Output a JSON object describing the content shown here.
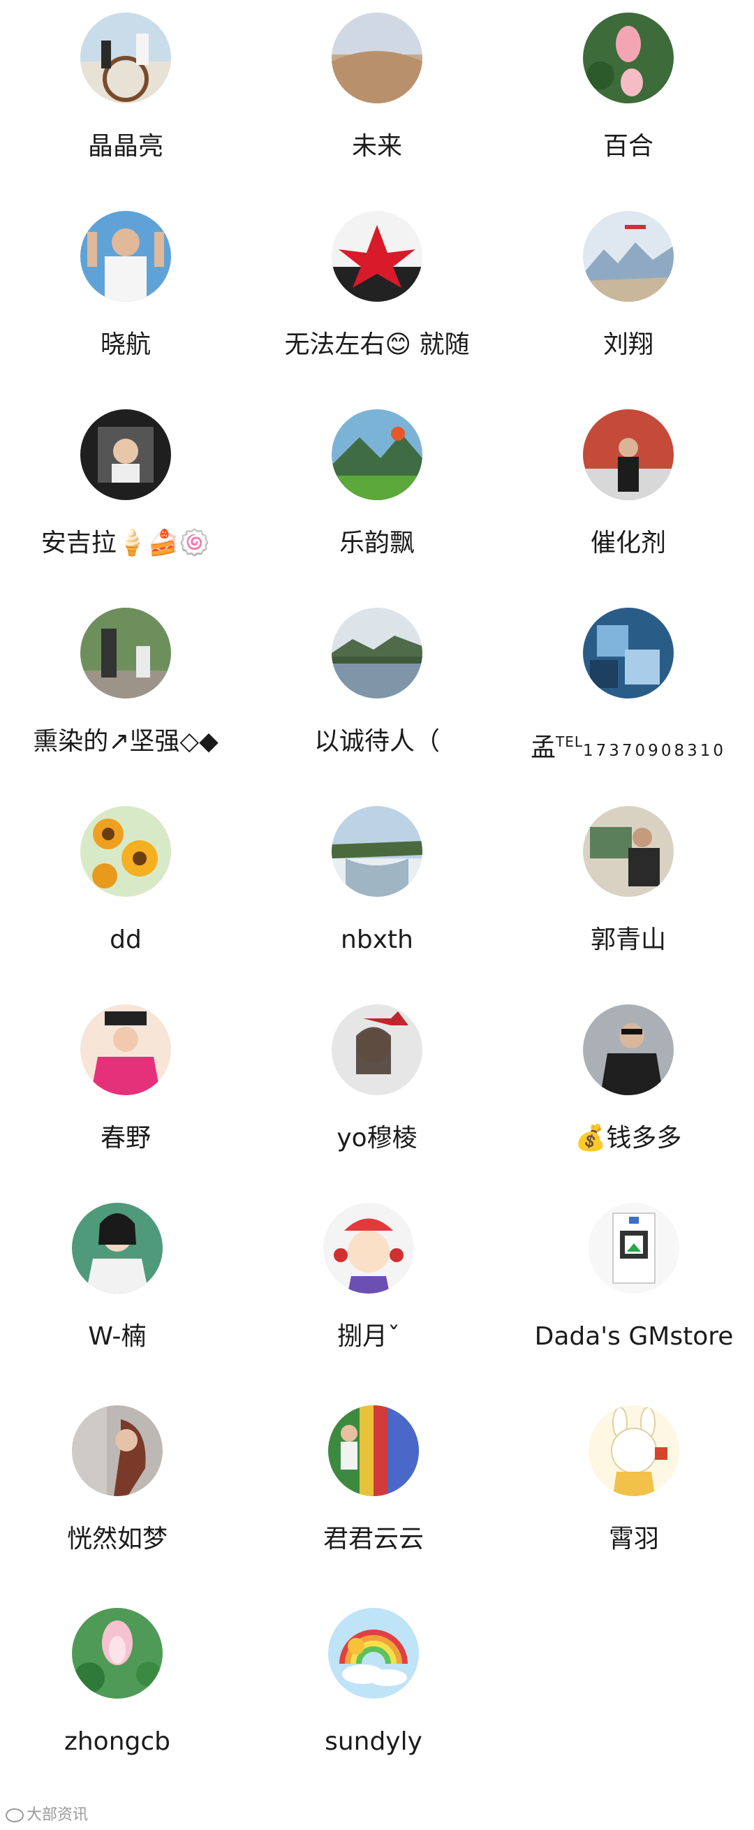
{
  "members": [
    {
      "name": "晶晶亮"
    },
    {
      "name": "未来"
    },
    {
      "name": "百合"
    },
    {
      "name": "晓航"
    },
    {
      "name": "无法左右😊 就随"
    },
    {
      "name": "刘翔"
    },
    {
      "name": "安吉拉🍦🍰🍥"
    },
    {
      "name": "乐韵飘"
    },
    {
      "name": "催化剂"
    },
    {
      "name": "熏染的↗坚强◇◆"
    },
    {
      "name": "以诚待人（"
    },
    {
      "name": "孟",
      "sup": "TEL",
      "phone": "17370908310"
    },
    {
      "name": "dd"
    },
    {
      "name": "nbxth"
    },
    {
      "name": "郭青山"
    },
    {
      "name": "春野"
    },
    {
      "name": "yo穆棱"
    },
    {
      "name": "💰钱多多"
    },
    {
      "name": "W-楠"
    },
    {
      "name": "捌月ˇ"
    },
    {
      "name": "Dada's GMstore"
    },
    {
      "name": "恍然如梦"
    },
    {
      "name": "君君云云"
    },
    {
      "name": "霄羽"
    },
    {
      "name": "zhongcb"
    },
    {
      "name": "sundyly"
    }
  ],
  "watermark": {
    "text": "大部资讯"
  }
}
